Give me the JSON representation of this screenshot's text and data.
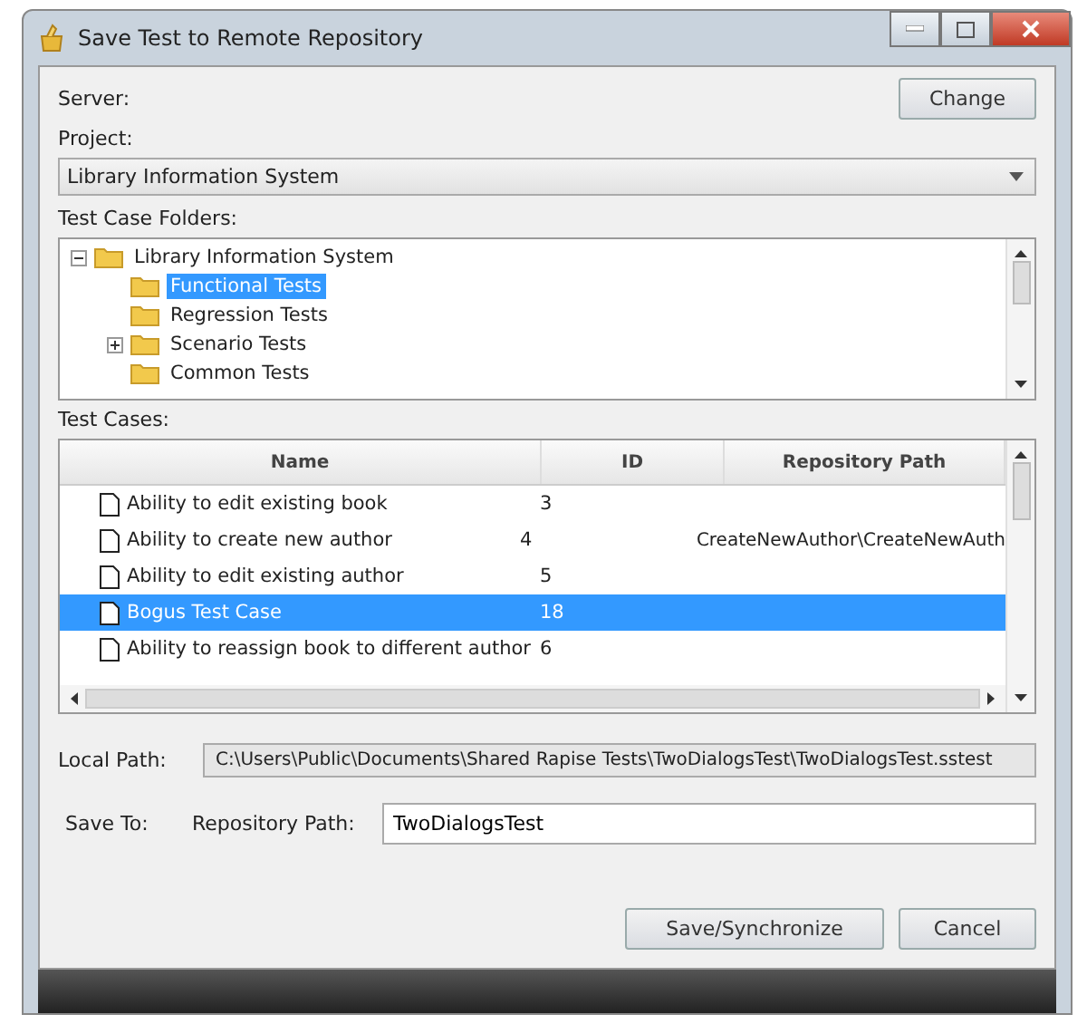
{
  "window": {
    "title": "Save Test to Remote Repository"
  },
  "server": {
    "label": "Server:",
    "button": "Change"
  },
  "project": {
    "label": "Project:",
    "value": "Library Information System"
  },
  "folders": {
    "label": "Test Case Folders:",
    "tree": [
      {
        "label": "Library Information System",
        "selected": false,
        "expanded": true,
        "children": [
          {
            "label": "Functional Tests",
            "selected": true
          },
          {
            "label": "Regression Tests",
            "selected": false
          },
          {
            "label": "Scenario Tests",
            "selected": false,
            "expanded": false
          },
          {
            "label": "Common Tests",
            "selected": false
          }
        ]
      }
    ]
  },
  "test_cases": {
    "label": "Test Cases:",
    "columns": [
      "Name",
      "ID",
      "Repository Path"
    ],
    "rows": [
      {
        "name": "Ability to edit existing book",
        "id": "3",
        "path": "",
        "selected": false
      },
      {
        "name": "Ability to create new author",
        "id": "4",
        "path": "CreateNewAuthor\\CreateNewAuth",
        "selected": false
      },
      {
        "name": "Ability to edit existing author",
        "id": "5",
        "path": "",
        "selected": false
      },
      {
        "name": "Bogus Test Case",
        "id": "18",
        "path": "",
        "selected": true
      },
      {
        "name": "Ability to reassign book to different author",
        "id": "6",
        "path": "",
        "selected": false
      }
    ]
  },
  "local_path": {
    "label": "Local Path:",
    "value": "C:\\Users\\Public\\Documents\\Shared Rapise Tests\\TwoDialogsTest\\TwoDialogsTest.sstest"
  },
  "save_to": {
    "label": "Save To:",
    "field_label": "Repository Path:",
    "value": "TwoDialogsTest"
  },
  "buttons": [
    "Save/Synchronize",
    "Cancel"
  ]
}
